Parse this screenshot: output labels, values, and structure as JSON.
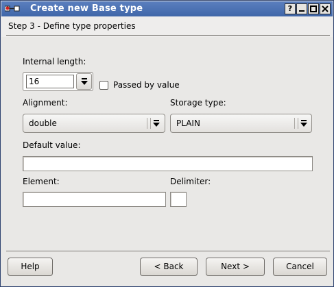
{
  "window": {
    "title": "Create new Base type",
    "buttons": {
      "help": "?",
      "minimize": "_",
      "maximize": "□",
      "close": "X"
    }
  },
  "header": {
    "step_title": "Step 3 - Define type properties"
  },
  "form": {
    "internal_length": {
      "label": "Internal length:",
      "value": "16"
    },
    "passed_by_value": {
      "label": "Passed by value",
      "checked": false
    },
    "alignment": {
      "label": "Alignment:",
      "value": "double"
    },
    "storage_type": {
      "label": "Storage type:",
      "value": "PLAIN"
    },
    "default_value": {
      "label": "Default value:",
      "value": ""
    },
    "element": {
      "label": "Element:",
      "value": ""
    },
    "delimiter": {
      "label": "Delimiter:",
      "value": ""
    }
  },
  "footer": {
    "help": "Help",
    "back": "< Back",
    "next": "Next >",
    "cancel": "Cancel"
  },
  "colors": {
    "titlebar": "#4a70b0",
    "window_bg": "#e9e8e6"
  }
}
